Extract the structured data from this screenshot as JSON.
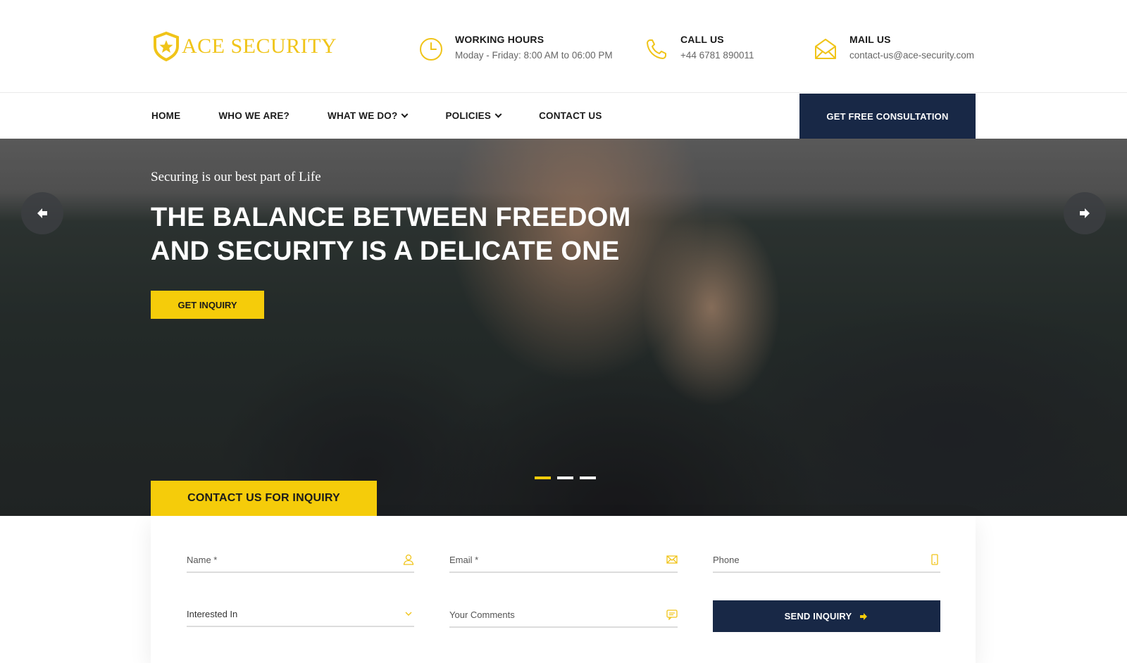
{
  "brand": {
    "name": "ACE SECURITY",
    "accent": "#F5CC0A",
    "navy": "#182846",
    "logo_icon": "shield-star-icon"
  },
  "header": {
    "hours": {
      "title": "WORKING HOURS",
      "value": "Moday - Friday: 8:00 AM to 06:00 PM",
      "icon": "clock-icon"
    },
    "call": {
      "title": "CALL US",
      "value": "+44 6781 890011",
      "icon": "phone-icon"
    },
    "mail": {
      "title": "MAIL US",
      "value": "contact-us@ace-security.com",
      "icon": "envelope-icon"
    }
  },
  "nav": {
    "items": [
      {
        "label": "HOME",
        "dropdown": false
      },
      {
        "label": "WHO WE ARE?",
        "dropdown": false
      },
      {
        "label": "WHAT WE DO?",
        "dropdown": true
      },
      {
        "label": "POLICIES",
        "dropdown": true
      },
      {
        "label": "CONTACT US",
        "dropdown": false
      }
    ],
    "cta": "GET FREE CONSULTATION"
  },
  "hero": {
    "subtitle": "Securing is our best part of Life",
    "title": "THE BALANCE BETWEEN FREEDOM AND SECURITY IS A DELICATE ONE",
    "button": "GET INQUIRY",
    "slides": 3,
    "active_slide": 1,
    "prev_icon": "arrow-left-icon",
    "next_icon": "arrow-right-icon"
  },
  "inquiry": {
    "tab_label": "CONTACT US FOR INQUIRY",
    "fields": {
      "name": {
        "placeholder": "Name *",
        "icon": "user-icon"
      },
      "email": {
        "placeholder": "Email *",
        "icon": "envelope-icon"
      },
      "phone": {
        "placeholder": "Phone",
        "icon": "mobile-icon"
      },
      "interest": {
        "value": "Interested In",
        "icon": "chevron-down-icon"
      },
      "comments": {
        "placeholder": "Your Comments",
        "icon": "chat-icon"
      }
    },
    "submit": "SEND INQUIRY"
  }
}
